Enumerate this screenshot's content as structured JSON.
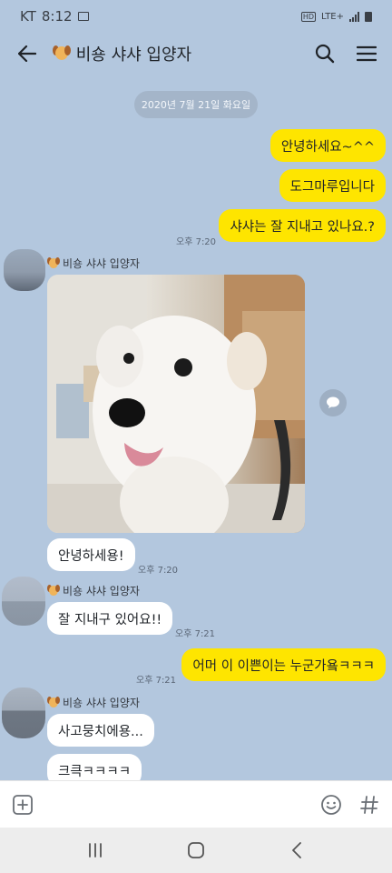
{
  "status_bar": {
    "carrier": "KT",
    "time": "8:12",
    "network": "LTE+"
  },
  "header": {
    "title": "비숑 샤샤 입양자"
  },
  "chat": {
    "date_divider": "2020년 7월 21일 화요일",
    "messages": [
      {
        "side": "mine",
        "text": "안녕하세요~^^"
      },
      {
        "side": "mine",
        "text": "도그마루입니다"
      },
      {
        "side": "mine",
        "text": "샤샤는 잘 지내고 있나요.?",
        "time": "오후 7:20"
      },
      {
        "side": "theirs",
        "sender": "비숑 샤샤 입양자",
        "type": "photo"
      },
      {
        "side": "theirs",
        "text": "안녕하세용!",
        "time": "오후 7:20"
      },
      {
        "side": "theirs",
        "sender": "비숑 샤샤 입양자",
        "text": "잘 지내구 있어요!!",
        "time": "오후 7:21"
      },
      {
        "side": "mine",
        "text": "어머 이 이쁜이는 누군가욬ㅋㅋㅋ",
        "time": "오후 7:21"
      },
      {
        "side": "theirs",
        "sender": "비숑 샤샤 입양자",
        "text": "사고뭉치에용..."
      },
      {
        "side": "theirs",
        "text": "크큭ㅋㅋㅋㅋ"
      }
    ]
  },
  "input": {
    "placeholder": ""
  },
  "colors": {
    "background": "#b3c7de",
    "my_bubble": "#fee500",
    "their_bubble": "#ffffff"
  }
}
